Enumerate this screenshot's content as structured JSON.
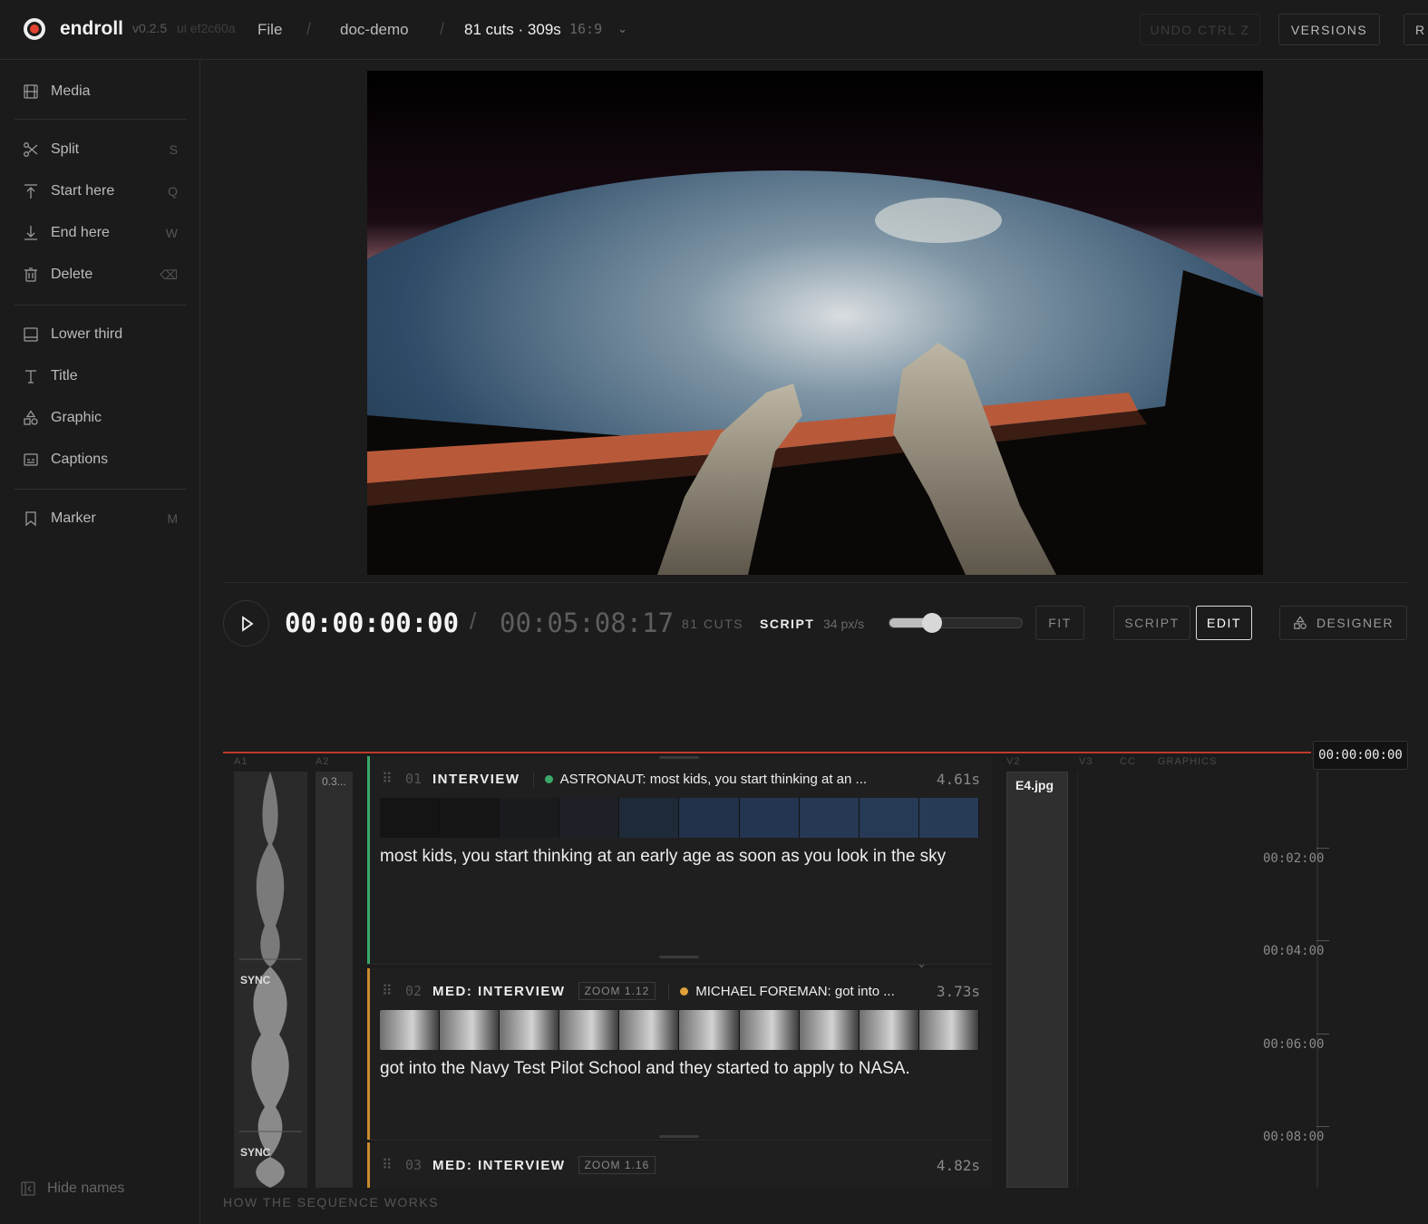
{
  "header": {
    "brand": "endroll",
    "version": "v0.2.5",
    "build": "ui ef2c60a",
    "file_menu": "File",
    "separator": "/",
    "project": "doc-demo",
    "cuts_summary": "81 cuts · 309s",
    "aspect_ratio": "16:9",
    "undo_label": "UNDO CTRL Z",
    "versions_label": "VERSIONS",
    "r_label": "R"
  },
  "sidebar": {
    "items": [
      {
        "label": "Media",
        "key": "",
        "icon": "film-icon"
      },
      {
        "label": "Split",
        "key": "S",
        "icon": "scissors-icon"
      },
      {
        "label": "Start here",
        "key": "Q",
        "icon": "arrow-up-bar-icon"
      },
      {
        "label": "End here",
        "key": "W",
        "icon": "arrow-down-bar-icon"
      },
      {
        "label": "Delete",
        "key": "⌫",
        "icon": "trash-icon"
      },
      {
        "label": "Lower third",
        "key": "",
        "icon": "lower-third-icon"
      },
      {
        "label": "Title",
        "key": "",
        "icon": "text-icon"
      },
      {
        "label": "Graphic",
        "key": "",
        "icon": "shapes-icon"
      },
      {
        "label": "Captions",
        "key": "",
        "icon": "captions-icon"
      },
      {
        "label": "Marker",
        "key": "M",
        "icon": "bookmark-icon"
      }
    ],
    "hide_names": "Hide names"
  },
  "transport": {
    "current_timecode": "00:00:00:00",
    "slash": "/",
    "total_timecode": "00:05:08:17",
    "cut_count": "81 CUTS",
    "mode_label": "SCRIPT",
    "zoom_value": "34 px/s",
    "zoom_level": 0.32,
    "fit_label": "FIT",
    "view_script": "SCRIPT",
    "view_edit": "EDIT",
    "designer_label": "DESIGNER"
  },
  "timeline": {
    "playhead_timecode": "00:00:00:00",
    "tracks": [
      "A1",
      "A2",
      "V2",
      "V3",
      "CC",
      "GRAPHICS"
    ],
    "a2_clip_label": "0.3...",
    "sync_label": "SYNC",
    "v2_clip_label": "E4.jpg",
    "ruler": [
      "00:02:00",
      "00:04:00",
      "00:06:00",
      "00:08:00"
    ]
  },
  "clips": [
    {
      "num": "01",
      "shot": "INTERVIEW",
      "zoom": "",
      "speaker": "ASTRONAUT: most kids, you start thinking at an ...",
      "dot_color": "#3aa868",
      "bar_color": "#3aa868",
      "duration": "4.61s",
      "text": "most kids, you start thinking at an early age as soon as you look in the sky"
    },
    {
      "num": "02",
      "shot": "MED: INTERVIEW",
      "zoom": "ZOOM 1.12",
      "speaker": "MICHAEL FOREMAN: got into ...",
      "dot_color": "#e0a13a",
      "bar_color": "#c98a2e",
      "duration": "3.73s",
      "text": "got into the Navy Test Pilot School and they started to apply to NASA."
    },
    {
      "num": "03",
      "shot": "MED: INTERVIEW",
      "zoom": "ZOOM 1.16",
      "speaker": "",
      "dot_color": "",
      "bar_color": "#c98a2e",
      "duration": "4.82s",
      "text": ""
    }
  ],
  "footer": {
    "how_label": "HOW THE SEQUENCE WORKS"
  }
}
